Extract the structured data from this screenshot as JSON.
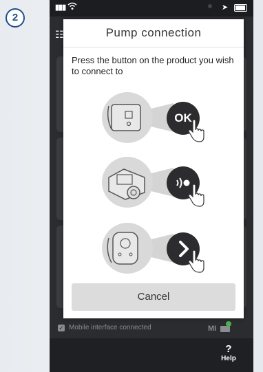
{
  "step_badge": "2",
  "dialog": {
    "title": "Pump connection",
    "instruction": "Press the button on the product you wish to connect to",
    "steps": [
      {
        "button_label": "OK",
        "button_icon": "ok-text"
      },
      {
        "button_label": "",
        "button_icon": "signal-waves-icon"
      },
      {
        "button_label": "",
        "button_icon": "chevron-right-icon"
      }
    ],
    "cancel_label": "Cancel"
  },
  "status": {
    "mobile_interface": "Mobile interface connected",
    "mi_label": "MI"
  },
  "footer": {
    "help_glyph": "?",
    "help_label": "Help"
  },
  "colors": {
    "badge": "#1b4f8c",
    "dark_button": "#2c2c2e",
    "indicator_green": "#4caf50"
  }
}
